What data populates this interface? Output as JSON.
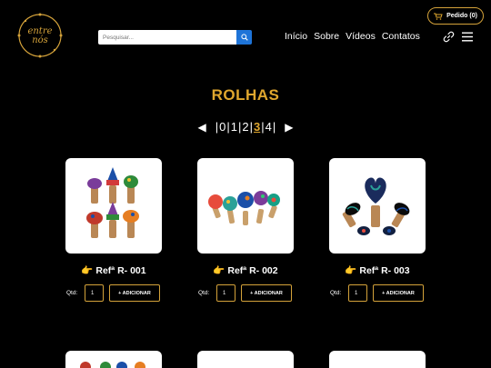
{
  "header": {
    "logo_text": "entre nós",
    "order_button": "Pedido (0)",
    "search_placeholder": "Pesquisar...",
    "nav": [
      "Início",
      "Sobre",
      "Vídeos",
      "Contatos"
    ]
  },
  "page": {
    "title": "ROLHAS",
    "pagination": {
      "prev": "◀",
      "next": "▶",
      "pages": [
        "0",
        "1",
        "2",
        "3",
        "4"
      ],
      "current": "3",
      "separator": "|"
    }
  },
  "products": [
    {
      "name": "👉 Refª R- 001",
      "qty_label": "Qtd:",
      "qty": "1",
      "add_label": "+ ADICIONAR"
    },
    {
      "name": "👉 Refª R- 002",
      "qty_label": "Qtd:",
      "qty": "1",
      "add_label": "+ ADICIONAR"
    },
    {
      "name": "👉 Refª R- 003",
      "qty_label": "Qtd:",
      "qty": "1",
      "add_label": "+ ADICIONAR"
    }
  ],
  "colors": {
    "background": "#000000",
    "accent": "#e0a72e",
    "border_accent": "#d4a23a",
    "search_button": "#1e74d8"
  },
  "icons": [
    "cart-icon",
    "search-icon",
    "link-icon",
    "menu-icon",
    "pointing-hand-icon"
  ]
}
